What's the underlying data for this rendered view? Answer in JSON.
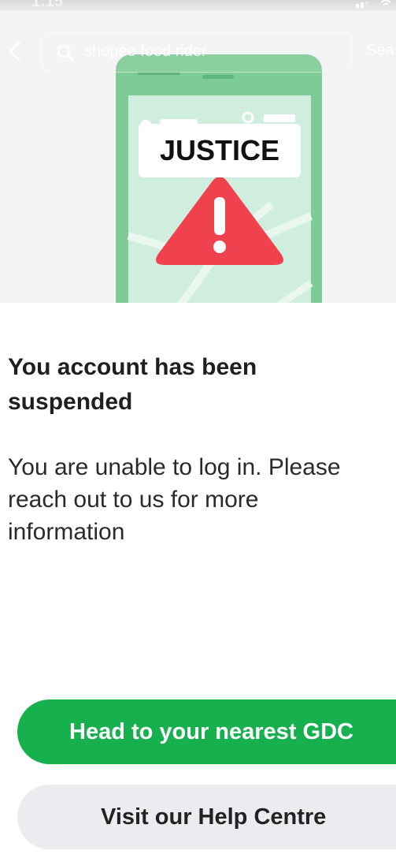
{
  "status_bar": {
    "time": "1:15"
  },
  "search": {
    "query": "shopee food rider",
    "button_label": "Sea",
    "icons": {
      "back": "chevron-left-icon",
      "search": "search-icon"
    }
  },
  "illustration": {
    "overlay_label": "JUSTICE",
    "icon": "warning-triangle-icon",
    "colors": {
      "phone_frame": "#7fcb97",
      "screen": "#cfeedd",
      "warning": "#f0414f"
    }
  },
  "notice": {
    "title": "You account has been suspended",
    "message_lines": [
      "You are unable to log in. Please",
      "reach out to us for more",
      "information"
    ]
  },
  "actions": {
    "primary_label": "Head to your nearest GDC",
    "secondary_label": "Visit our Help Centre"
  },
  "colors": {
    "primary": "#16b14e",
    "secondary_bg": "#ecebf0",
    "text": "#1f1f1f"
  }
}
